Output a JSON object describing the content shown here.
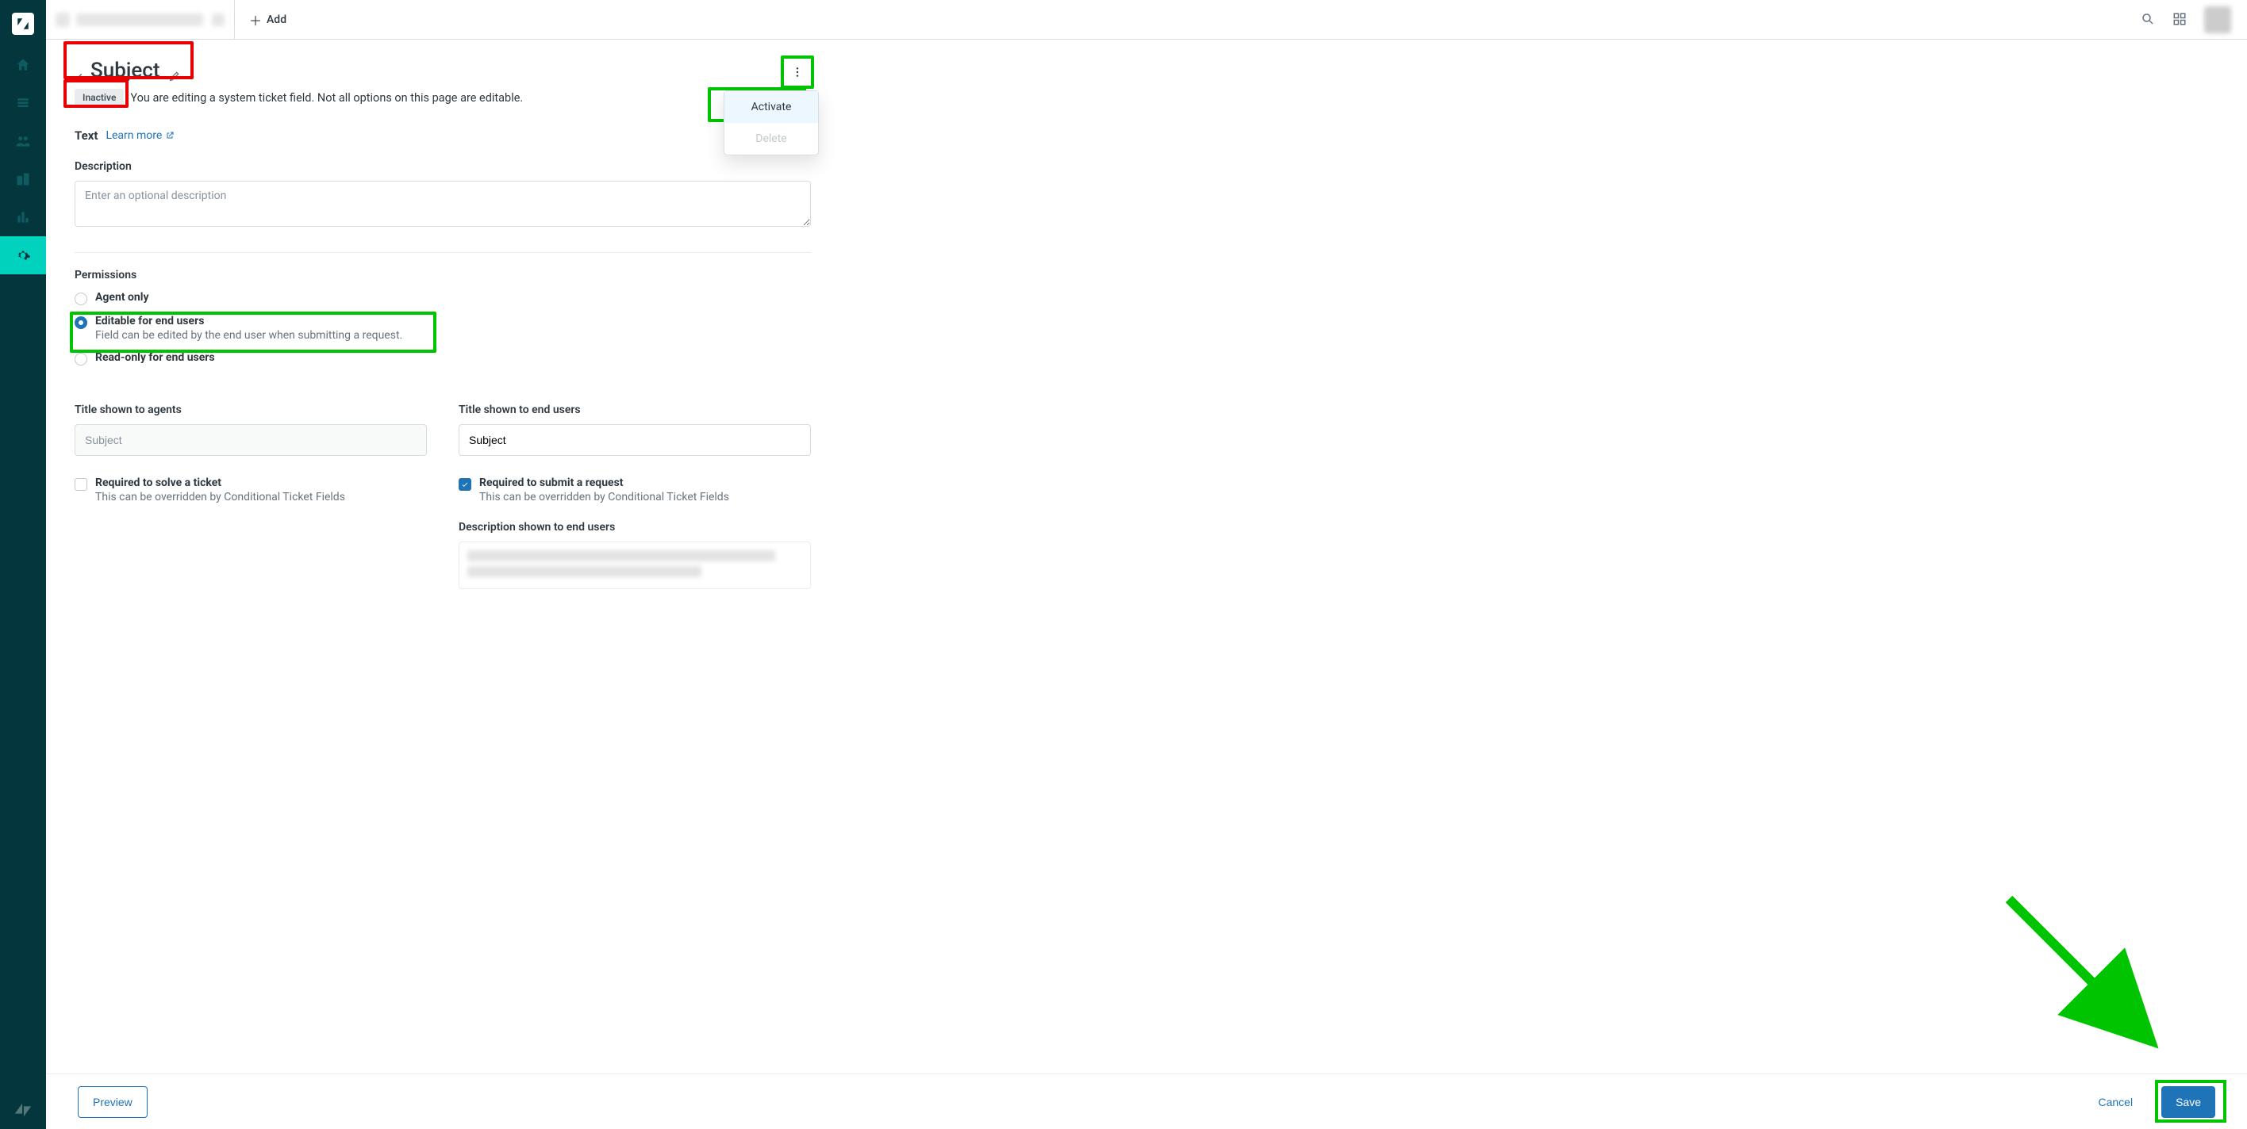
{
  "topbar": {
    "add_label": "Add"
  },
  "header": {
    "title": "Subject",
    "status": "Inactive",
    "status_desc": "You are editing a system ticket field. Not all options on this page are editable."
  },
  "dropdown": {
    "activate": "Activate",
    "delete": "Delete"
  },
  "type_section": {
    "type": "Text",
    "learn_more": "Learn more"
  },
  "description": {
    "label": "Description",
    "placeholder": "Enter an optional description",
    "value": ""
  },
  "permissions": {
    "label": "Permissions",
    "options": {
      "agent_only": "Agent only",
      "editable": "Editable for end users",
      "editable_sub": "Field can be edited by the end user when submitting a request.",
      "readonly": "Read-only for end users"
    },
    "selected": "editable"
  },
  "titles": {
    "agents_label": "Title shown to agents",
    "agents_value": "Subject",
    "endusers_label": "Title shown to end users",
    "endusers_value": "Subject"
  },
  "required": {
    "solve_label": "Required to solve a ticket",
    "solve_sub": "This can be overridden by Conditional Ticket Fields",
    "solve_checked": false,
    "submit_label": "Required to submit a request",
    "submit_sub": "This can be overridden by Conditional Ticket Fields",
    "submit_checked": true
  },
  "desc_end_users": {
    "label": "Description shown to end users"
  },
  "footer": {
    "preview": "Preview",
    "cancel": "Cancel",
    "save": "Save"
  }
}
